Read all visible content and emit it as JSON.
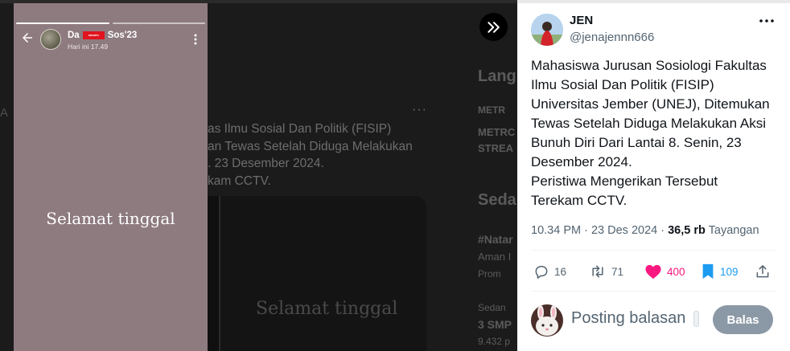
{
  "story": {
    "user_prefix": "Da",
    "user_suffix": "Sos'23",
    "redaction_text": "rasmin",
    "time": "Hari ini 17.49",
    "caption": "Selamat tinggal"
  },
  "background": {
    "post_lines": [
      "as Ilmu Sosial Dan Politik (FISIP)",
      "an Tewas Setelah Diduga Melakukan",
      ". 23 Desember 2024.",
      "kam CCTV."
    ],
    "media_caption": "Selamat tinggal",
    "sidebar_fragments": [
      "Lang",
      "METR",
      "METRC",
      "STREA",
      "Seda",
      "#Natar",
      "Aman I",
      "Prom",
      "Sedan",
      "3 SMP",
      "9.432 p"
    ]
  },
  "expand_button_label": "»",
  "tweet": {
    "author_name": "JEN",
    "author_handle": "@jenajennn666",
    "text_lines": [
      "Mahasiswa Jurusan Sosiologi Fakultas",
      "Ilmu Sosial Dan Politik (FISIP)",
      "Universitas Jember (UNEJ), Ditemukan",
      "Tewas Setelah Diduga Melakukan Aksi",
      "Bunuh Diri Dari Lantai 8. Senin, 23",
      "Desember 2024.",
      "Peristiwa Mengerikan Tersebut",
      "Terekam CCTV."
    ],
    "time": "10.34 PM",
    "date": "23 Des 2024",
    "views_count": "36,5 rb",
    "views_label": "Tayangan",
    "replies": "16",
    "retweets": "71",
    "likes": "400",
    "bookmarks": "109"
  },
  "reply": {
    "placeholder": "Posting balasan",
    "button_label": "Balas"
  },
  "colors": {
    "like": "#f91880",
    "bookmark": "#1d9bf0",
    "story_bg": "#8e7b80",
    "reply_button": "#8b98a5"
  }
}
